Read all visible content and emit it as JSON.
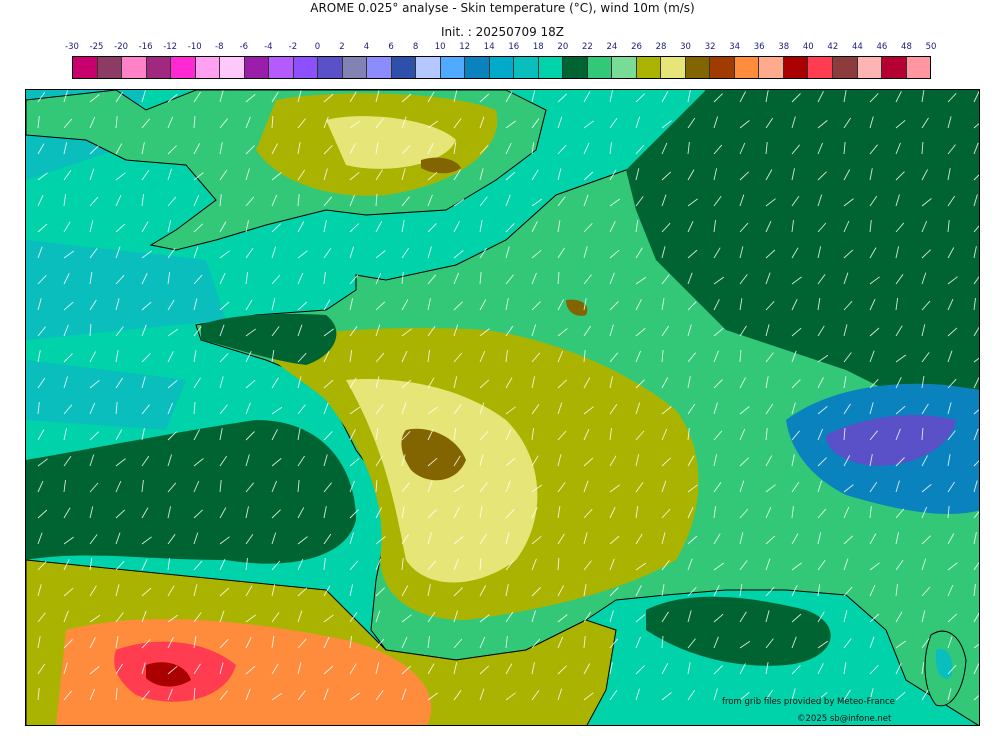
{
  "header": {
    "title": "AROME 0.025° analyse - Skin temperature (°C), wind 10m (m/s)",
    "init": "Init. : 20250709 18Z"
  },
  "colorbar": {
    "labels": [
      "-30",
      "-25",
      "-20",
      "-16",
      "-12",
      "-10",
      "-8",
      "-6",
      "-4",
      "-2",
      "0",
      "2",
      "4",
      "6",
      "8",
      "10",
      "12",
      "14",
      "16",
      "18",
      "20",
      "22",
      "24",
      "26",
      "28",
      "30",
      "32",
      "34",
      "36",
      "38",
      "40",
      "42",
      "44",
      "46",
      "48",
      "50"
    ],
    "colors": [
      "#c8006e",
      "#8c3c64",
      "#ff82c8",
      "#a0287e",
      "#ff28d2",
      "#ffa0f0",
      "#ffc8fa",
      "#9b1eaa",
      "#b45aff",
      "#8c50ff",
      "#5a50c8",
      "#8282b4",
      "#8c8cff",
      "#2d50aa",
      "#b4c8ff",
      "#50aaff",
      "#0a82be",
      "#00aac8",
      "#0abebe",
      "#00d2aa",
      "#006432",
      "#32c878",
      "#78dc96",
      "#aab400",
      "#e6e678",
      "#826400",
      "#a03c00",
      "#ff8c3c",
      "#ffaa8c",
      "#aa0000",
      "#ff3c50",
      "#8c3c3c",
      "#ffb4b4",
      "#b40032",
      "#ff96a0"
    ]
  },
  "map": {
    "region": "France and surroundings",
    "sea_color": "#00d2aa",
    "land_color": "#32c878",
    "coast_color": "#000000"
  },
  "credits": {
    "source": "from grib files provided by Meteo-France",
    "copyright": "©2025 sb@infone.net"
  }
}
